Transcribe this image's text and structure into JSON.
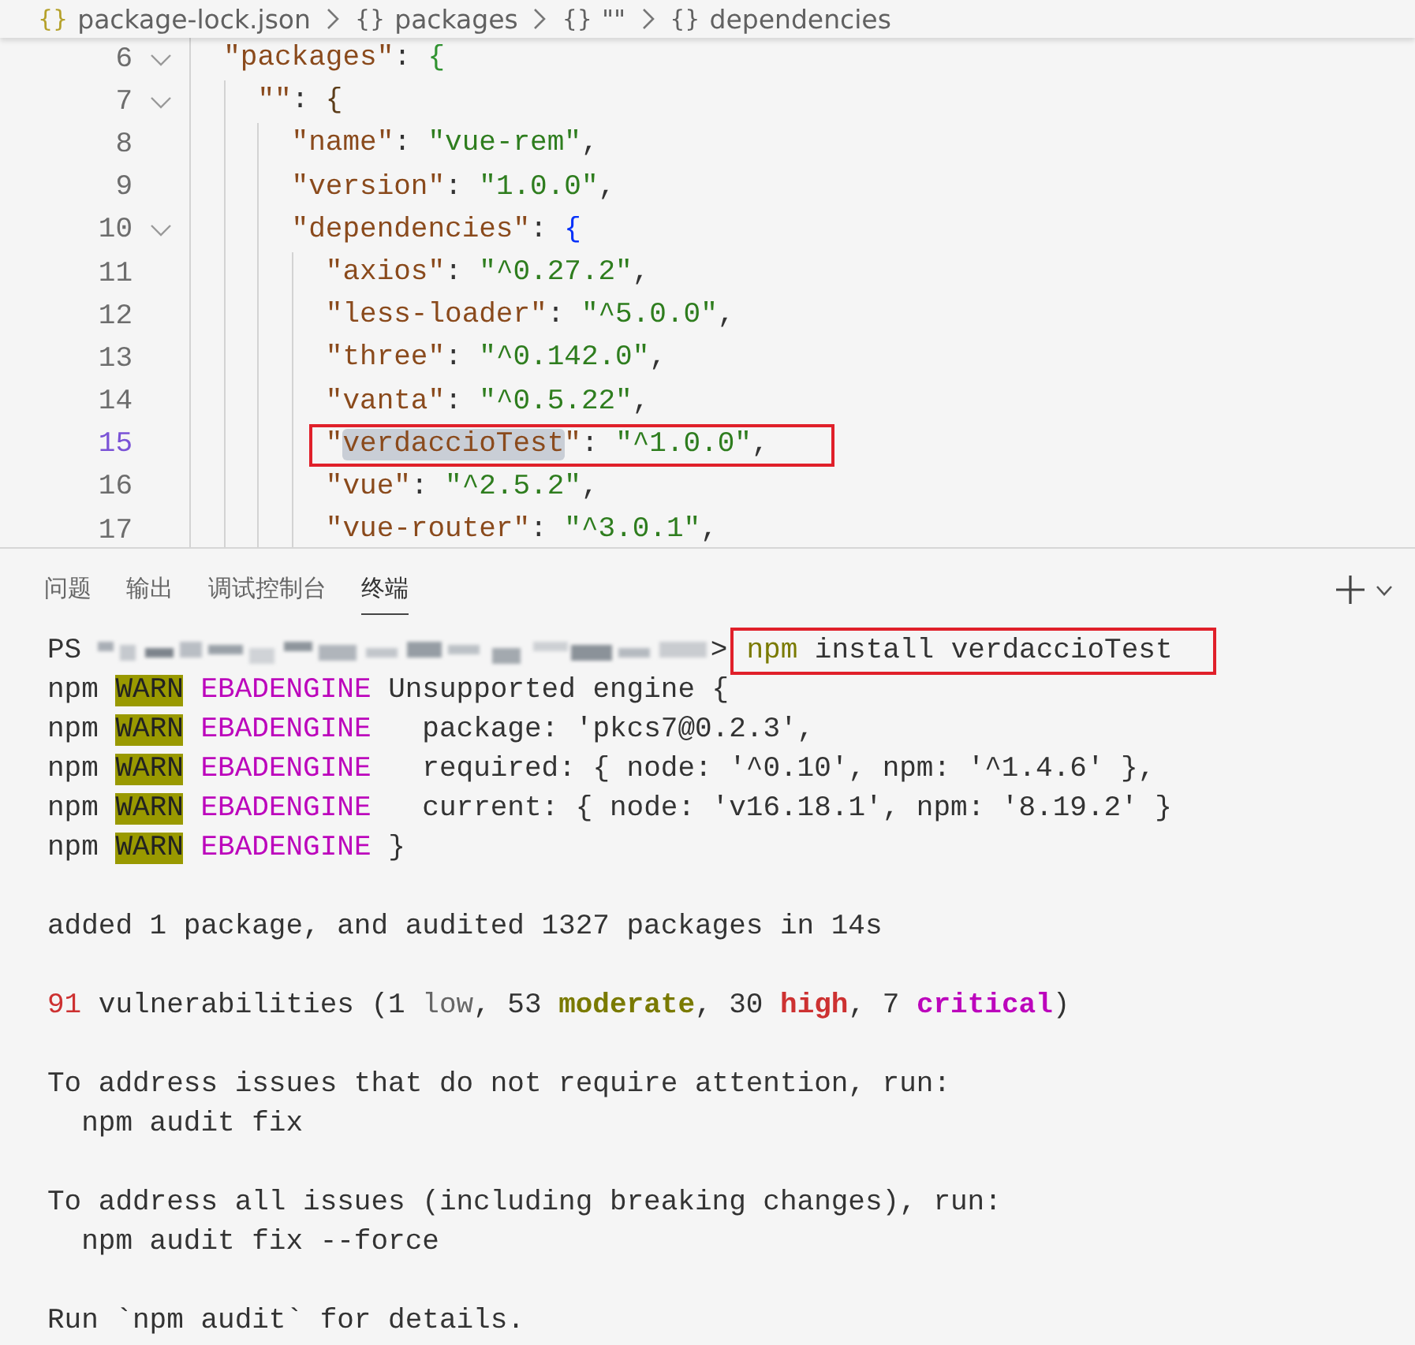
{
  "breadcrumb": [
    {
      "kind": "file",
      "icon": "{}",
      "label": "package-lock.json"
    },
    {
      "kind": "object",
      "icon": "{}",
      "label": "packages"
    },
    {
      "kind": "object",
      "icon": "{}",
      "label": "\"\""
    },
    {
      "kind": "object",
      "icon": "{}",
      "label": "dependencies"
    }
  ],
  "editor": {
    "lines": [
      {
        "number": "6",
        "foldable": true,
        "current": false,
        "boxed": false,
        "tokens": [
          {
            "kind": "key",
            "text": "  \"packages\""
          },
          {
            "kind": "punct",
            "text": ": "
          },
          {
            "kind": "brace",
            "color": "#319331",
            "text": "{"
          }
        ]
      },
      {
        "number": "7",
        "foldable": true,
        "current": false,
        "boxed": false,
        "tokens": [
          {
            "kind": "key",
            "text": "    \"\""
          },
          {
            "kind": "punct",
            "text": ": "
          },
          {
            "kind": "brace",
            "color": "#5c3d1a",
            "text": "{"
          }
        ]
      },
      {
        "number": "8",
        "foldable": false,
        "current": false,
        "boxed": false,
        "tokens": [
          {
            "kind": "key",
            "text": "      \"name\""
          },
          {
            "kind": "punct",
            "text": ": "
          },
          {
            "kind": "string",
            "text": "\"vue-rem\""
          },
          {
            "kind": "punct",
            "text": ","
          }
        ]
      },
      {
        "number": "9",
        "foldable": false,
        "current": false,
        "boxed": false,
        "tokens": [
          {
            "kind": "key",
            "text": "      \"version\""
          },
          {
            "kind": "punct",
            "text": ": "
          },
          {
            "kind": "string",
            "text": "\"1.0.0\""
          },
          {
            "kind": "punct",
            "text": ","
          }
        ]
      },
      {
        "number": "10",
        "foldable": true,
        "current": false,
        "boxed": false,
        "tokens": [
          {
            "kind": "key",
            "text": "      \"dependencies\""
          },
          {
            "kind": "punct",
            "text": ": "
          },
          {
            "kind": "brace",
            "color": "#0431fa",
            "text": "{"
          }
        ]
      },
      {
        "number": "11",
        "foldable": false,
        "current": false,
        "boxed": false,
        "tokens": [
          {
            "kind": "key",
            "text": "        \"axios\""
          },
          {
            "kind": "punct",
            "text": ": "
          },
          {
            "kind": "string",
            "text": "\"^0.27.2\""
          },
          {
            "kind": "punct",
            "text": ","
          }
        ]
      },
      {
        "number": "12",
        "foldable": false,
        "current": false,
        "boxed": false,
        "tokens": [
          {
            "kind": "key",
            "text": "        \"less-loader\""
          },
          {
            "kind": "punct",
            "text": ": "
          },
          {
            "kind": "string",
            "text": "\"^5.0.0\""
          },
          {
            "kind": "punct",
            "text": ","
          }
        ]
      },
      {
        "number": "13",
        "foldable": false,
        "current": false,
        "boxed": false,
        "tokens": [
          {
            "kind": "key",
            "text": "        \"three\""
          },
          {
            "kind": "punct",
            "text": ": "
          },
          {
            "kind": "string",
            "text": "\"^0.142.0\""
          },
          {
            "kind": "punct",
            "text": ","
          }
        ]
      },
      {
        "number": "14",
        "foldable": false,
        "current": false,
        "boxed": false,
        "tokens": [
          {
            "kind": "key",
            "text": "        \"vanta\""
          },
          {
            "kind": "punct",
            "text": ": "
          },
          {
            "kind": "string",
            "text": "\"^0.5.22\""
          },
          {
            "kind": "punct",
            "text": ","
          }
        ]
      },
      {
        "number": "15",
        "foldable": false,
        "current": true,
        "boxed": true,
        "tokens": [
          {
            "kind": "key",
            "text": "        \""
          },
          {
            "kind": "match",
            "text": "verdaccioTest"
          },
          {
            "kind": "key",
            "text": "\""
          },
          {
            "kind": "punct",
            "text": ": "
          },
          {
            "kind": "string",
            "text": "\"^1.0.0\""
          },
          {
            "kind": "punct",
            "text": ","
          }
        ]
      },
      {
        "number": "16",
        "foldable": false,
        "current": false,
        "boxed": false,
        "tokens": [
          {
            "kind": "key",
            "text": "        \"vue\""
          },
          {
            "kind": "punct",
            "text": ": "
          },
          {
            "kind": "string",
            "text": "\"^2.5.2\""
          },
          {
            "kind": "punct",
            "text": ","
          }
        ]
      },
      {
        "number": "17",
        "foldable": false,
        "current": false,
        "boxed": false,
        "tokens": [
          {
            "kind": "key",
            "text": "        \"vue-router\""
          },
          {
            "kind": "punct",
            "text": ": "
          },
          {
            "kind": "string",
            "text": "\"^3.0.1\""
          },
          {
            "kind": "punct",
            "text": ","
          }
        ]
      }
    ]
  },
  "panel": {
    "tabs": [
      {
        "label": "问题",
        "selected": false
      },
      {
        "label": "输出",
        "selected": false
      },
      {
        "label": "调试控制台",
        "selected": false
      },
      {
        "label": "终端",
        "selected": true
      }
    ],
    "terminal": {
      "lines": [
        {
          "segments": [
            {
              "kind": "plain",
              "text": "PS "
            },
            {
              "kind": "redacted"
            },
            {
              "kind": "plain",
              "text": ">"
            },
            {
              "kind": "boxed",
              "segments": [
                {
                  "kind": "npm",
                  "text": "npm"
                },
                {
                  "kind": "plain",
                  "text": " install verdaccioTest"
                }
              ]
            }
          ]
        },
        {
          "segments": [
            {
              "kind": "plain",
              "text": "npm "
            },
            {
              "kind": "warn",
              "text": "WARN"
            },
            {
              "kind": "engine",
              "text": " EBADENGINE"
            },
            {
              "kind": "plain",
              "text": " Unsupported engine {"
            }
          ]
        },
        {
          "segments": [
            {
              "kind": "plain",
              "text": "npm "
            },
            {
              "kind": "warn",
              "text": "WARN"
            },
            {
              "kind": "engine",
              "text": " EBADENGINE"
            },
            {
              "kind": "plain",
              "text": "   package: 'pkcs7@0.2.3',"
            }
          ]
        },
        {
          "segments": [
            {
              "kind": "plain",
              "text": "npm "
            },
            {
              "kind": "warn",
              "text": "WARN"
            },
            {
              "kind": "engine",
              "text": " EBADENGINE"
            },
            {
              "kind": "plain",
              "text": "   required: { node: '^0.10', npm: '^1.4.6' },"
            }
          ]
        },
        {
          "segments": [
            {
              "kind": "plain",
              "text": "npm "
            },
            {
              "kind": "warn",
              "text": "WARN"
            },
            {
              "kind": "engine",
              "text": " EBADENGINE"
            },
            {
              "kind": "plain",
              "text": "   current: { node: 'v16.18.1', npm: '8.19.2' }"
            }
          ]
        },
        {
          "segments": [
            {
              "kind": "plain",
              "text": "npm "
            },
            {
              "kind": "warn",
              "text": "WARN"
            },
            {
              "kind": "engine",
              "text": " EBADENGINE"
            },
            {
              "kind": "plain",
              "text": " }"
            }
          ]
        },
        {
          "segments": [
            {
              "kind": "blank"
            }
          ]
        },
        {
          "segments": [
            {
              "kind": "plain",
              "text": "added 1 package, and audited 1327 packages in 14s"
            }
          ]
        },
        {
          "segments": [
            {
              "kind": "blank"
            }
          ]
        },
        {
          "segments": [
            {
              "kind": "red",
              "text": "91"
            },
            {
              "kind": "plain",
              "text": " vulnerabilities (1 "
            },
            {
              "kind": "gray",
              "text": "low"
            },
            {
              "kind": "plain",
              "text": ", 53 "
            },
            {
              "kind": "olive-bold",
              "text": "moderate"
            },
            {
              "kind": "plain",
              "text": ", 30 "
            },
            {
              "kind": "red-bold",
              "text": "high"
            },
            {
              "kind": "plain",
              "text": ", 7 "
            },
            {
              "kind": "magenta-bold",
              "text": "critical"
            },
            {
              "kind": "plain",
              "text": ")"
            }
          ]
        },
        {
          "segments": [
            {
              "kind": "blank"
            }
          ]
        },
        {
          "segments": [
            {
              "kind": "plain",
              "text": "To address issues that do not require attention, run:"
            }
          ]
        },
        {
          "segments": [
            {
              "kind": "plain",
              "text": "  npm audit fix"
            }
          ]
        },
        {
          "segments": [
            {
              "kind": "blank"
            }
          ]
        },
        {
          "segments": [
            {
              "kind": "plain",
              "text": "To address all issues (including breaking changes), run:"
            }
          ]
        },
        {
          "segments": [
            {
              "kind": "plain",
              "text": "  npm audit fix --force"
            }
          ]
        },
        {
          "segments": [
            {
              "kind": "blank"
            }
          ]
        },
        {
          "segments": [
            {
              "kind": "plain",
              "text": "Run `npm audit` for details."
            }
          ]
        }
      ]
    }
  }
}
